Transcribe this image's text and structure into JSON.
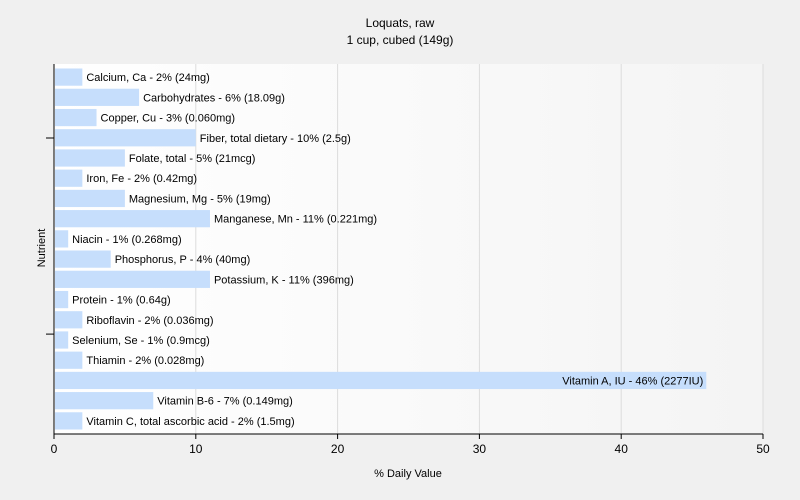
{
  "chart_data": {
    "type": "bar",
    "orientation": "horizontal",
    "title": "Loquats, raw",
    "subtitle": "1 cup, cubed (149g)",
    "xlabel": "% Daily Value",
    "ylabel": "Nutrient",
    "xlim": [
      0,
      50
    ],
    "xticks": [
      0,
      10,
      20,
      30,
      40,
      50
    ],
    "grid": true,
    "bar_color": "#c6defc",
    "categories": [
      "Calcium, Ca",
      "Carbohydrates",
      "Copper, Cu",
      "Fiber, total dietary",
      "Folate, total",
      "Iron, Fe",
      "Magnesium, Mg",
      "Manganese, Mn",
      "Niacin",
      "Phosphorus, P",
      "Potassium, K",
      "Protein",
      "Riboflavin",
      "Selenium, Se",
      "Thiamin",
      "Vitamin A, IU",
      "Vitamin B-6",
      "Vitamin C, total ascorbic acid"
    ],
    "values": [
      2,
      6,
      3,
      10,
      5,
      2,
      5,
      11,
      1,
      4,
      11,
      1,
      2,
      1,
      2,
      46,
      7,
      2
    ],
    "labels": [
      "Calcium, Ca - 2% (24mg)",
      "Carbohydrates - 6% (18.09g)",
      "Copper, Cu - 3% (0.060mg)",
      "Fiber, total dietary - 10% (2.5g)",
      "Folate, total - 5% (21mcg)",
      "Iron, Fe - 2% (0.42mg)",
      "Magnesium, Mg - 5% (19mg)",
      "Manganese, Mn - 11% (0.221mg)",
      "Niacin - 1% (0.268mg)",
      "Phosphorus, P - 4% (40mg)",
      "Potassium, K - 11% (396mg)",
      "Protein - 1% (0.64g)",
      "Riboflavin - 2% (0.036mg)",
      "Selenium, Se - 1% (0.9mcg)",
      "Thiamin - 2% (0.028mg)",
      "Vitamin A, IU - 46% (2277IU)",
      "Vitamin B-6 - 7% (0.149mg)",
      "Vitamin C, total ascorbic acid - 2% (1.5mg)"
    ]
  }
}
